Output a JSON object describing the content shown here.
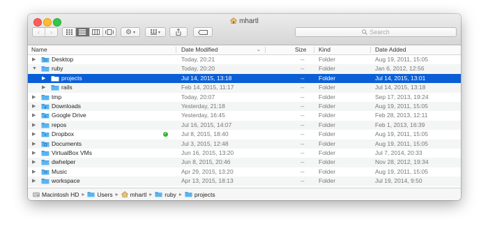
{
  "window": {
    "title": "mhartl"
  },
  "toolbar": {
    "search_placeholder": "Search",
    "view_modes": [
      "icon-view",
      "list-view",
      "column-view",
      "coverflow-view"
    ],
    "active_view": "list-view"
  },
  "columns": {
    "name": "Name",
    "date_modified": "Date Modified",
    "size": "Size",
    "kind": "Kind",
    "date_added": "Date Added"
  },
  "rows": [
    {
      "name": "Desktop",
      "date_modified": "Today, 20:21",
      "size": "--",
      "kind": "Folder",
      "date_added": "Aug 19, 2011, 15:05",
      "indent": 0,
      "expanded": false,
      "icon": "desktop-folder-icon"
    },
    {
      "name": "ruby",
      "date_modified": "Today, 20:20",
      "size": "--",
      "kind": "Folder",
      "date_added": "Jan 6, 2012, 12:56",
      "indent": 0,
      "expanded": true,
      "icon": "folder-icon"
    },
    {
      "name": "projects",
      "date_modified": "Jul 14, 2015, 13:18",
      "size": "--",
      "kind": "Folder",
      "date_added": "Jul 14, 2015, 13:01",
      "indent": 1,
      "expanded": false,
      "selected": true,
      "icon": "folder-icon"
    },
    {
      "name": "rails",
      "date_modified": "Feb 14, 2015, 11:17",
      "size": "--",
      "kind": "Folder",
      "date_added": "Jul 14, 2015, 13:18",
      "indent": 1,
      "expanded": false,
      "icon": "folder-icon"
    },
    {
      "name": "tmp",
      "date_modified": "Today, 20:07",
      "size": "--",
      "kind": "Folder",
      "date_added": "Sep 17, 2013, 19:24",
      "indent": 0,
      "expanded": false,
      "icon": "folder-icon"
    },
    {
      "name": "Downloads",
      "date_modified": "Yesterday, 21:18",
      "size": "--",
      "kind": "Folder",
      "date_added": "Aug 19, 2011, 15:05",
      "indent": 0,
      "expanded": false,
      "icon": "downloads-folder-icon"
    },
    {
      "name": "Google Drive",
      "date_modified": "Yesterday, 16:45",
      "size": "--",
      "kind": "Folder",
      "date_added": "Feb 28, 2013, 12:11",
      "indent": 0,
      "expanded": false,
      "icon": "google-drive-folder-icon"
    },
    {
      "name": "repos",
      "date_modified": "Jul 16, 2015, 14:07",
      "size": "--",
      "kind": "Folder",
      "date_added": "Feb 1, 2013, 16:39",
      "indent": 0,
      "expanded": false,
      "icon": "folder-icon"
    },
    {
      "name": "Dropbox",
      "date_modified": "Jul 8, 2015, 18:40",
      "size": "--",
      "kind": "Folder",
      "date_added": "Aug 19, 2011, 15:05",
      "indent": 0,
      "expanded": false,
      "icon": "dropbox-folder-icon",
      "synced": true
    },
    {
      "name": "Documents",
      "date_modified": "Jul 3, 2015, 12:48",
      "size": "--",
      "kind": "Folder",
      "date_added": "Aug 19, 2011, 15:05",
      "indent": 0,
      "expanded": false,
      "icon": "documents-folder-icon"
    },
    {
      "name": "VirtualBox VMs",
      "date_modified": "Jun 16, 2015, 13:20",
      "size": "--",
      "kind": "Folder",
      "date_added": "Jul 7, 2014, 20:33",
      "indent": 0,
      "expanded": false,
      "icon": "folder-icon"
    },
    {
      "name": "dwhelper",
      "date_modified": "Jun 8, 2015, 20:46",
      "size": "--",
      "kind": "Folder",
      "date_added": "Nov 28, 2012, 19:34",
      "indent": 0,
      "expanded": false,
      "icon": "folder-icon"
    },
    {
      "name": "Music",
      "date_modified": "Apr 29, 2015, 13:20",
      "size": "--",
      "kind": "Folder",
      "date_added": "Aug 19, 2011, 15:05",
      "indent": 0,
      "expanded": false,
      "icon": "music-folder-icon"
    },
    {
      "name": "workspace",
      "date_modified": "Apr 13, 2015, 18:13",
      "size": "--",
      "kind": "Folder",
      "date_added": "Jul 19, 2014, 9:50",
      "indent": 0,
      "expanded": false,
      "icon": "folder-icon"
    }
  ],
  "pathbar": [
    {
      "label": "Macintosh HD",
      "icon": "hard-drive-icon"
    },
    {
      "label": "Users",
      "icon": "folder-icon"
    },
    {
      "label": "mhartl",
      "icon": "home-icon"
    },
    {
      "label": "ruby",
      "icon": "folder-icon"
    },
    {
      "label": "projects",
      "icon": "folder-icon"
    }
  ],
  "colors": {
    "selection": "#0a5fd6",
    "folder": "#5ab5f0",
    "sync_badge": "#2eb82e"
  }
}
